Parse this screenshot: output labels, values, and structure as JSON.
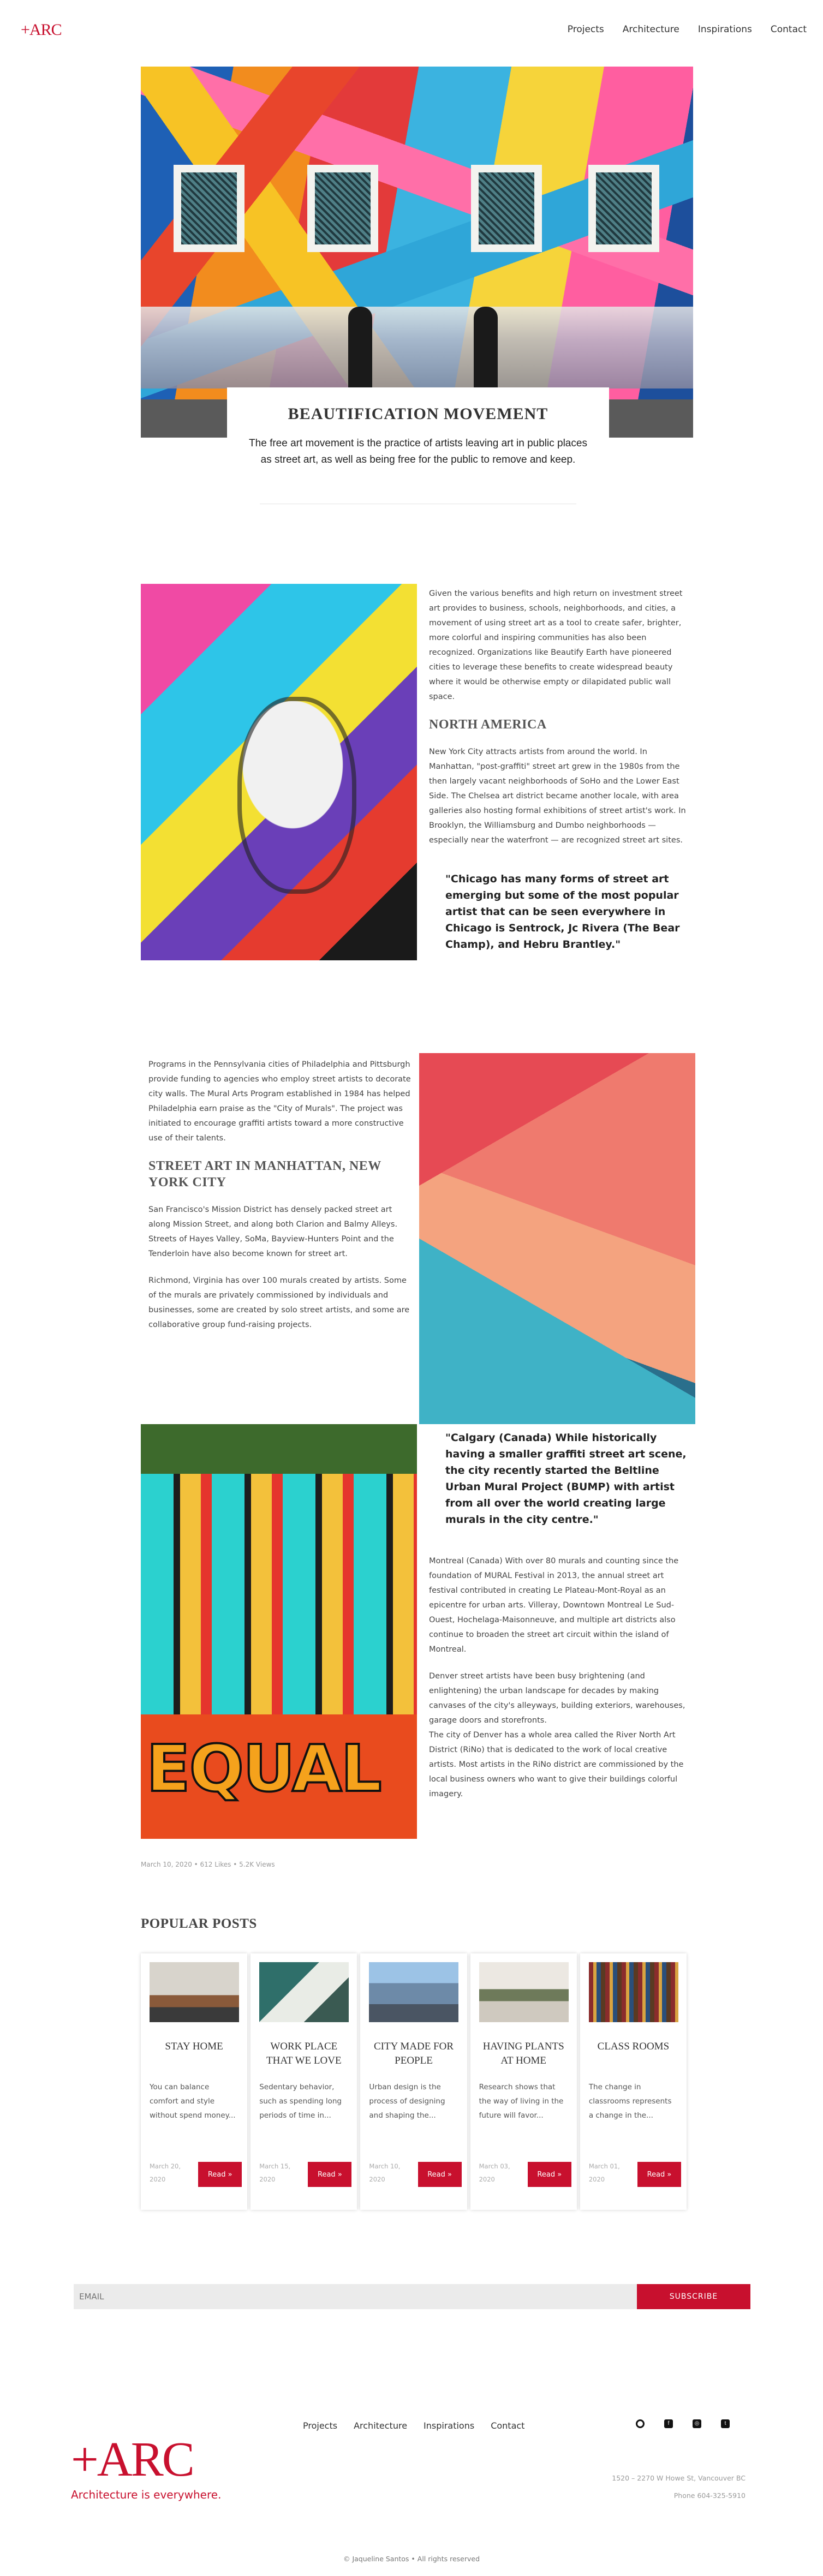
{
  "header": {
    "logo": "+ARC",
    "nav": [
      "Projects",
      "Architecture",
      "Inspirations",
      "Contact"
    ]
  },
  "hero": {
    "title": "BEAUTIFICATION MOVEMENT",
    "subtitle": "The free art movement is the practice of artists leaving art in public places as street art, as well as being free for the public to remove and keep."
  },
  "article": {
    "intro": "Given the various benefits and high return on investment street art provides to business, schools, neighborhoods, and cities, a movement of using street art as a tool to create safer, brighter, more colorful and inspiring communities has also been recognized. Organizations like Beautify Earth have pioneered cities to leverage these benefits to create widespread beauty where it would be otherwise empty or dilapidated public wall space.",
    "north_america_heading": "NORTH AMERICA",
    "north_america_text": "New York City attracts artists from around the world. In Manhattan, \"post-graffiti\" street art grew in the 1980s from the then largely vacant neighborhoods of SoHo and the Lower East Side. The Chelsea art district became another locale, with area galleries also hosting formal exhibitions of street artist's work. In Brooklyn, the Williamsburg and Dumbo neighborhoods — especially near the waterfront — are recognized street art sites.",
    "quote_chicago": "\"Chicago has many forms of street art emerging but some of the most popular artist that can be seen everywhere in Chicago is Sentrock, Jc Rivera (The Bear Champ), and Hebru Brantley.\"",
    "philly_text": "Programs in the Pennsylvania cities of Philadelphia and Pittsburgh provide funding to agencies who employ street artists to decorate city walls. The Mural Arts Program established in 1984 has helped Philadelphia earn praise as the \"City of Murals\". The project was initiated to encourage graffiti artists toward a more constructive use of their talents.",
    "manhattan_heading": "STREET ART IN MANHATTAN, NEW YORK CITY",
    "sf_text": "San Francisco's Mission District has densely packed street art along Mission Street, and along both Clarion and Balmy Alleys. Streets of Hayes Valley, SoMa, Bayview-Hunters Point and the Tenderloin have also become known for street art.",
    "richmond_text": "Richmond, Virginia has over 100 murals created by artists. Some of the murals are privately commissioned by individuals and businesses, some are created by solo street artists, and some are collaborative group fund-raising projects.",
    "quote_calgary": "\"Calgary (Canada) While historically having a smaller graffiti street art scene, the city recently started the Beltline Urban Mural Project (BUMP) with artist from all over the world creating large murals in the city centre.\"",
    "montreal_text": "Montreal (Canada) With over 80 murals and counting since the foundation of MURAL Festival in 2013, the annual street art festival contributed in creating Le Plateau-Mont-Royal as an epicentre for urban arts. Villeray, Downtown Montreal Le Sud-Ouest, Hochelaga-Maisonneuve, and multiple art districts also continue to broaden the street art circuit within the island of Montreal.",
    "denver_text": "Denver street artists have been busy brightening (and enlightening) the urban landscape for decades by making canvases of the city's alleyways, building exteriors, warehouses, garage doors and storefronts.\nThe city of Denver has a whole area called the River North Art District (RiNo) that is dedicated to the work of local creative artists. Most artists in the RiNo district are commissioned by the local business owners who want to give their buildings colorful imagery.",
    "equal_word": "EQUAL",
    "meta": "March 10, 2020 • 612 Likes • 5.2K Views"
  },
  "popular": {
    "heading": "POPULAR POSTS",
    "posts": [
      {
        "title": "STAY HOME",
        "excerpt": "You can balance comfort and style without spend money...",
        "date": "March 20, 2020",
        "button": "Read »"
      },
      {
        "title": "WORK PLACE THAT WE LOVE",
        "excerpt": "Sedentary behavior, such as spending long periods of time in...",
        "date": "March 15, 2020",
        "button": "Read »"
      },
      {
        "title": "CITY MADE FOR PEOPLE",
        "excerpt": "Urban design is the process of designing and shaping the...",
        "date": "March 10, 2020",
        "button": "Read »"
      },
      {
        "title": "HAVING PLANTS AT HOME",
        "excerpt": "Research shows that the way of living in the future will favor...",
        "date": "March 03, 2020",
        "button": "Read »"
      },
      {
        "title": "CLASS ROOMS",
        "excerpt": "The change in classrooms represents a change in the...",
        "date": "March 01, 2020",
        "button": "Read »"
      }
    ]
  },
  "newsletter": {
    "placeholder": "EMAIL",
    "button": "SUBSCRIBE"
  },
  "footer": {
    "nav": [
      "Projects",
      "Architecture",
      "Inspirations",
      "Contact"
    ],
    "logo": "+ARC",
    "tagline": "Architecture is everywhere.",
    "address": "1520 – 2270 W Howe St, Vancouver BC",
    "phone": "Phone 604-325-5910",
    "copyright": "© Jaqueline Santos • All rights reserved"
  },
  "colors": {
    "accent": "#c8102e"
  }
}
